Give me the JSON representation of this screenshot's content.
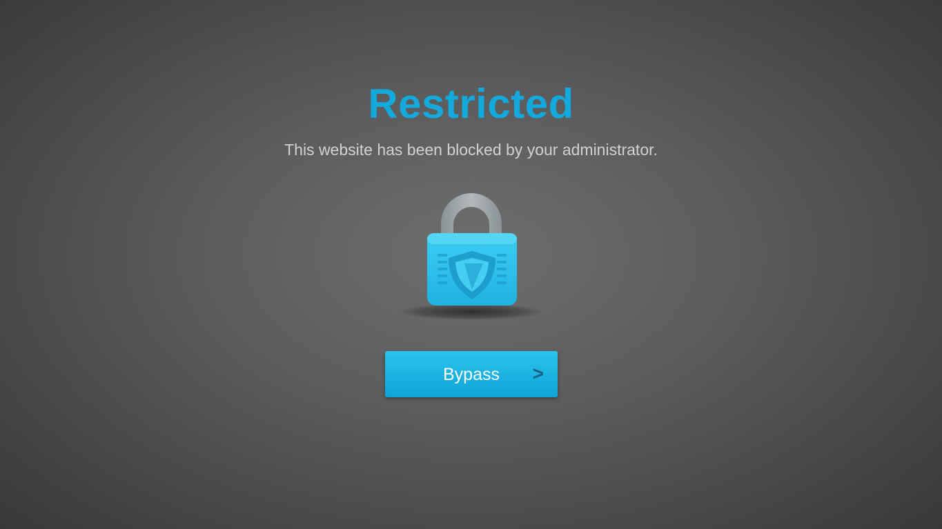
{
  "page": {
    "title": "Restricted",
    "message": "This website has been blocked by your administrator."
  },
  "lock": {
    "icon": "padlock-shield-icon"
  },
  "bypass": {
    "label": "Bypass",
    "chevron": ">",
    "icon": "chevron-right-icon"
  },
  "colors": {
    "accent": "#13a9dc",
    "button_top": "#2ac3ec",
    "button_bottom": "#0fa4d8",
    "shackle": "#9aa1a3",
    "lock_body": "#2bbfe9"
  }
}
